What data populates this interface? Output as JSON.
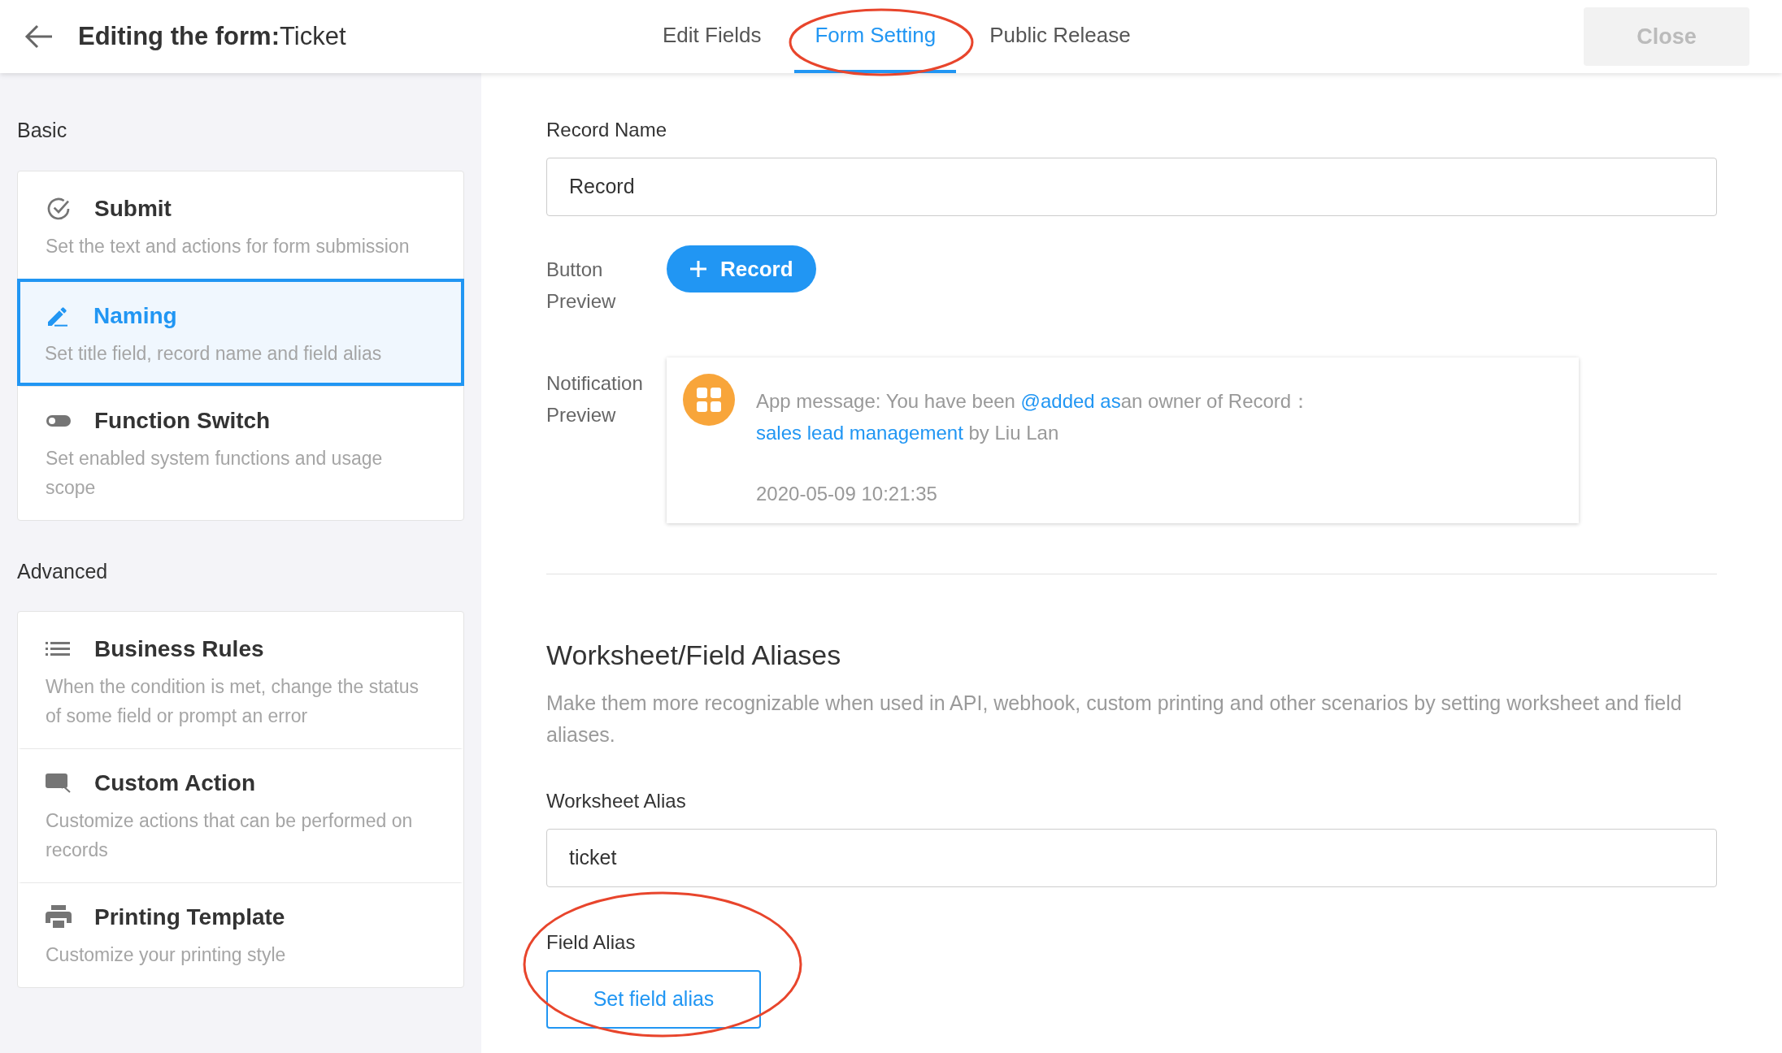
{
  "header": {
    "title": "**Editing the form:**Ticket",
    "tabs": [
      {
        "label": "Edit Fields",
        "selected": false
      },
      {
        "label": "Form Setting",
        "selected": true,
        "circled": true
      },
      {
        "label": "Public Release",
        "selected": false
      }
    ],
    "close_button": {
      "label": "Close",
      "disabled": true
    }
  },
  "sidebar": {
    "groups": [
      {
        "heading": "Basic",
        "items": [
          {
            "kind": "submit",
            "title": "Submit",
            "description": "Set the text and actions for form submission",
            "selected": false
          },
          {
            "kind": "naming",
            "title": "Naming",
            "description": "Set title field, record name and field alias",
            "selected": true
          },
          {
            "kind": "switch",
            "title": "Function Switch",
            "description": "Set enabled system functions and usage scope",
            "selected": false
          }
        ]
      },
      {
        "heading": "Advanced",
        "items": [
          {
            "kind": "rules",
            "title": "Business Rules",
            "description": "When the condition is met, change the status of some field or prompt an error",
            "selected": false
          },
          {
            "kind": "action",
            "title": "Custom Action",
            "description": "Customize actions that can be performed on records",
            "selected": false
          },
          {
            "kind": "print",
            "title": "Printing Template",
            "description": "Customize your printing style",
            "selected": false
          }
        ]
      }
    ]
  },
  "record_name": {
    "label": "Record Name",
    "value": "Record"
  },
  "button_preview": {
    "label": "Button Preview",
    "button": "Record"
  },
  "notification_preview": {
    "label": "Notification Preview",
    "message": [
      {
        "text": "App message: You have been ",
        "link": false
      },
      {
        "text": "@added as",
        "link": true
      },
      {
        "text": "an owner of Record：",
        "link": false
      },
      {
        "text": "sales lead management",
        "link": true
      },
      {
        "text": " by Liu Lan",
        "link": false
      }
    ],
    "time": "2020-05-09 10:21:35"
  },
  "aliases": {
    "title": "Worksheet/Field Aliases",
    "description": "Make them more recognizable when used in API, webhook, custom printing and other scenarios by setting worksheet and field aliases.",
    "worksheet_alias": {
      "label": "Worksheet Alias",
      "value": "ticket"
    },
    "field_alias": {
      "label": "Field Alias",
      "button": "Set field alias",
      "circled": true
    }
  }
}
